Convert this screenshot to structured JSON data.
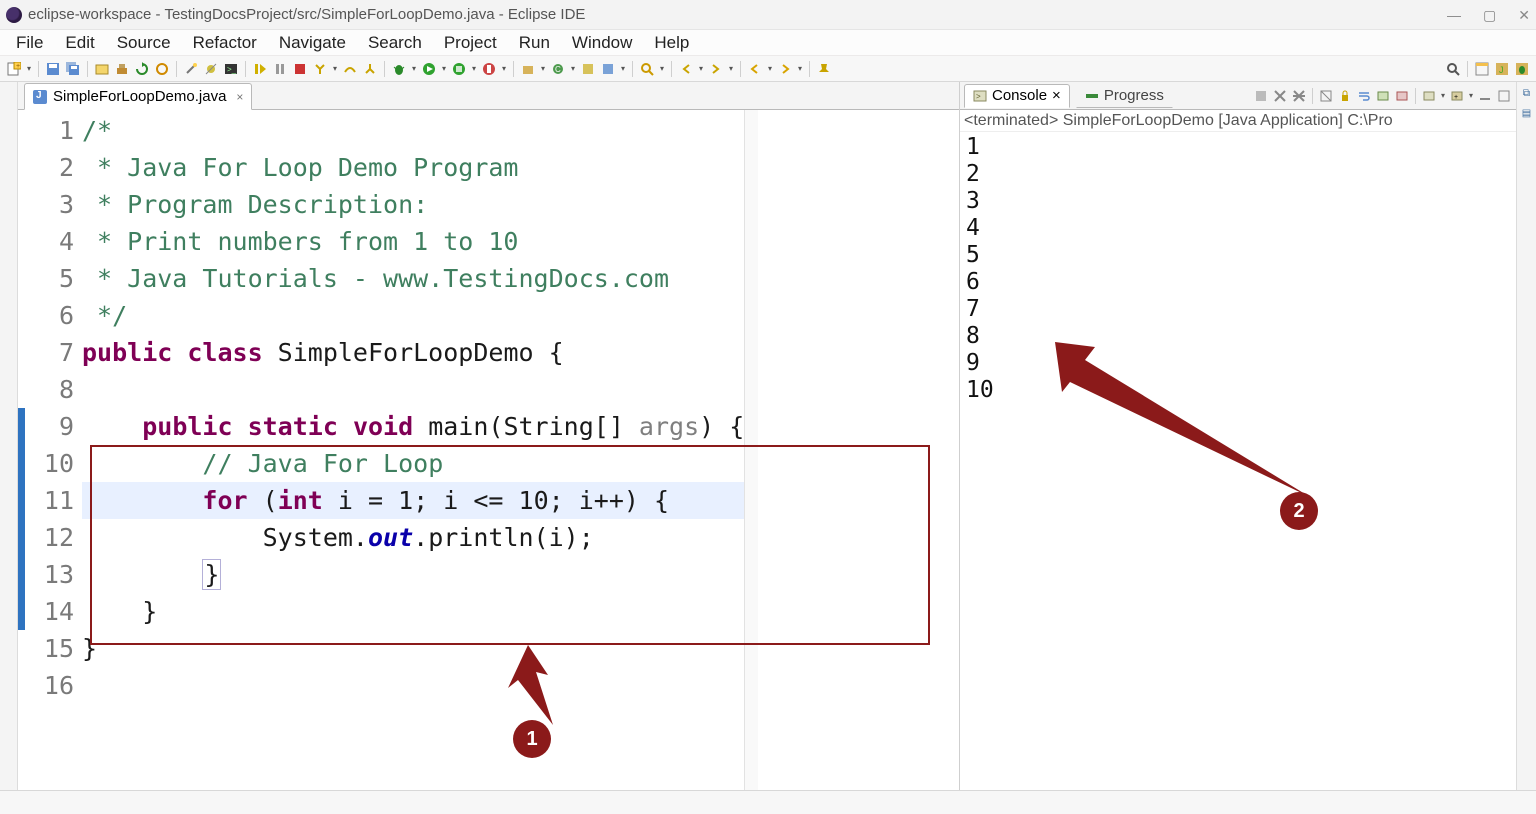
{
  "window": {
    "title": "eclipse-workspace - TestingDocsProject/src/SimpleForLoopDemo.java - Eclipse IDE"
  },
  "menu": [
    "File",
    "Edit",
    "Source",
    "Refactor",
    "Navigate",
    "Search",
    "Project",
    "Run",
    "Window",
    "Help"
  ],
  "editor_tab": {
    "label": "SimpleForLoopDemo.java"
  },
  "code": {
    "lines": [
      {
        "n": "1",
        "seg": [
          [
            "/*",
            "c-comment"
          ]
        ]
      },
      {
        "n": "2",
        "seg": [
          [
            " * Java For Loop Demo Program",
            "c-comment"
          ]
        ]
      },
      {
        "n": "3",
        "seg": [
          [
            " * Program Description:",
            "c-comment"
          ]
        ]
      },
      {
        "n": "4",
        "seg": [
          [
            " * Print numbers from 1 to 10",
            "c-comment"
          ]
        ]
      },
      {
        "n": "5",
        "seg": [
          [
            " * Java Tutorials - www.TestingDocs.com",
            "c-comment"
          ]
        ]
      },
      {
        "n": "6",
        "seg": [
          [
            " */",
            "c-comment"
          ]
        ]
      },
      {
        "n": "7",
        "seg": [
          [
            "public ",
            "c-kw"
          ],
          [
            "class ",
            "c-kw"
          ],
          [
            "SimpleForLoopDemo {",
            ""
          ]
        ]
      },
      {
        "n": "8",
        "seg": [
          [
            "",
            ""
          ]
        ]
      },
      {
        "n": "9",
        "seg": [
          [
            "    ",
            ""
          ],
          [
            "public ",
            "c-kw"
          ],
          [
            "static ",
            "c-kw"
          ],
          [
            "void ",
            "c-kw"
          ],
          [
            "main(String[] ",
            ""
          ],
          [
            "args",
            "c-arg"
          ],
          [
            ") {",
            ""
          ]
        ]
      },
      {
        "n": "10",
        "seg": [
          [
            "        ",
            ""
          ],
          [
            "// Java For Loop",
            "c-comment"
          ]
        ]
      },
      {
        "n": "11",
        "hl": true,
        "seg": [
          [
            "        ",
            ""
          ],
          [
            "for ",
            "c-kw"
          ],
          [
            "(",
            ""
          ],
          [
            "int ",
            "c-kw"
          ],
          [
            "i = 1; i <= 10; i++) {",
            ""
          ]
        ]
      },
      {
        "n": "12",
        "seg": [
          [
            "            System.",
            ""
          ],
          [
            "out",
            "c-static"
          ],
          [
            ".println(i);",
            ""
          ]
        ]
      },
      {
        "n": "13",
        "seg": [
          [
            "        ",
            ""
          ],
          [
            "}",
            "matched-brace"
          ]
        ]
      },
      {
        "n": "14",
        "seg": [
          [
            "    }",
            ""
          ]
        ]
      },
      {
        "n": "15",
        "seg": [
          [
            "}",
            ""
          ]
        ]
      },
      {
        "n": "16",
        "seg": [
          [
            "",
            ""
          ]
        ]
      }
    ]
  },
  "console_tab": {
    "label": "Console"
  },
  "progress_tab": {
    "label": "Progress"
  },
  "console_status": "<terminated> SimpleForLoopDemo [Java Application] C:\\Pro",
  "console_output": [
    "1",
    "2",
    "3",
    "4",
    "5",
    "6",
    "7",
    "8",
    "9",
    "10"
  ],
  "annotations": {
    "badge1": "1",
    "badge2": "2"
  }
}
